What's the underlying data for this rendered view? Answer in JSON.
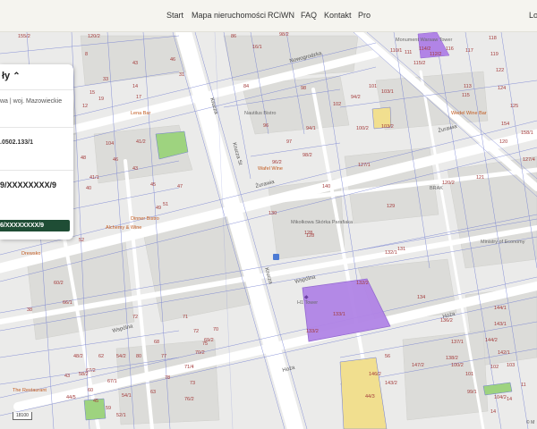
{
  "nav": {
    "items": [
      "Start",
      "Mapa nieruchomości",
      "RCiWN",
      "FAQ",
      "Kontakt",
      "Pro"
    ],
    "login": "Lo"
  },
  "panel": {
    "title": "ły",
    "location": "wa | woj. Mazowieckie",
    "parcel_id": ".0502.133/1",
    "kw_number": "9/XXXXXXXX/9",
    "kw_number_2": "6/XXXXXXXX/9"
  },
  "map": {
    "streets": [
      "Nowogrodzka",
      "Żurawia",
      "Krucza",
      "Wspólna",
      "Hoża",
      "Krucza St"
    ],
    "pois": [
      "Monument Warsaw Tower",
      "Nautilus Bistro",
      "Wedel Wine Bar",
      "Lena Bar",
      "Wafel Wine",
      "Mikołkowa Skórka Parafiaka",
      "Ministry of Economy",
      "Dinner Bistro",
      "H1 Tower",
      "Alchemy & Wine",
      "The Restaurant",
      "Drewsko",
      "BRAK"
    ],
    "parcels": [
      "155/2",
      "120/2",
      "86",
      "98/2",
      "8",
      "43",
      "46",
      "31",
      "14",
      "33",
      "12",
      "14",
      "17",
      "19",
      "12",
      "15",
      "16/1",
      "84",
      "98",
      "96",
      "94/1",
      "97",
      "96/2",
      "98/2",
      "94/2",
      "102",
      "100/2",
      "101",
      "103/1",
      "103/2",
      "104",
      "48",
      "41/1",
      "41/2",
      "46",
      "40",
      "37",
      "33",
      "43",
      "47",
      "42",
      "35",
      "45",
      "49",
      "51",
      "52",
      "60/2",
      "66/1",
      "72",
      "80",
      "38",
      "127/1",
      "128",
      "129",
      "130",
      "131",
      "120/2",
      "140",
      "128",
      "132/1",
      "132/2",
      "134",
      "133/1",
      "133/2",
      "136/2",
      "137/1",
      "138/2",
      "144/1",
      "143/1",
      "144/2",
      "142/1",
      "113",
      "115",
      "116",
      "117",
      "118",
      "119",
      "122",
      "124",
      "125",
      "154",
      "158/1",
      "120",
      "127/4",
      "121",
      "111",
      "115/2",
      "110/1",
      "114/2",
      "112/2",
      "71",
      "72",
      "75",
      "70",
      "69/2",
      "71/4",
      "70/2",
      "73",
      "76/2",
      "78",
      "77",
      "68",
      "63",
      "62",
      "58/2",
      "54/1",
      "67/1",
      "52/1",
      "59",
      "60",
      "67/2",
      "54/2",
      "48/2",
      "43",
      "44/5",
      "45",
      "44/3",
      "56",
      "146/2",
      "143/2",
      "147/2",
      "100/2",
      "101",
      "102",
      "103",
      "104/2",
      "14",
      "99/1",
      "11",
      "14"
    ],
    "scale": "18100",
    "attribution": "© M"
  },
  "colors": {
    "topbar_bg": "#f5f4ef",
    "kw_badge_bg": "#1f4d35",
    "selected_parcel": "#b184e6",
    "green_parcel": "#9ed37f",
    "yellow_parcel": "#f1df8f",
    "parcel_line": "#6f7bd0",
    "parcel_label": "#a33a3a"
  }
}
